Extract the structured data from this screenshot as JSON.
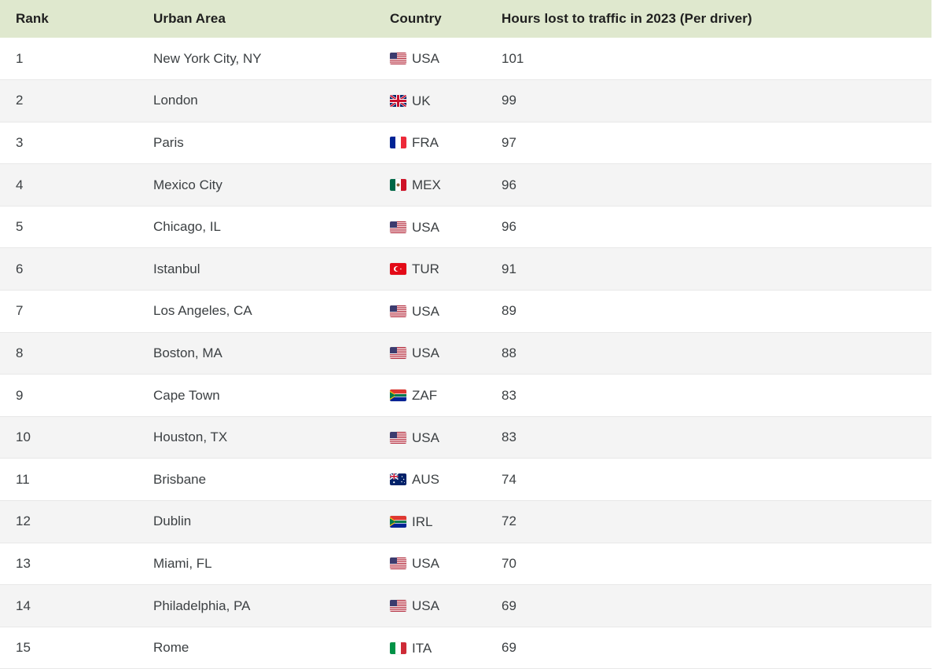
{
  "table": {
    "name": "traffic-congestion-ranking",
    "columns": [
      {
        "key": "rank",
        "label": "Rank"
      },
      {
        "key": "area",
        "label": "Urban Area"
      },
      {
        "key": "country",
        "label": "Country"
      },
      {
        "key": "hours",
        "label": "Hours lost to traffic in 2023 (Per driver)"
      }
    ],
    "colors": {
      "header_background": "#dfe8ce",
      "header_text": "#1f1f1f",
      "row_odd_background": "#ffffff",
      "row_even_background": "#f4f4f4",
      "row_border": "#e8e8e8",
      "body_text": "#3c4043"
    },
    "rows": [
      {
        "rank": "1",
        "area": "New York City, NY",
        "country": "USA",
        "flag": "flag-usa",
        "hours": "101"
      },
      {
        "rank": "2",
        "area": "London",
        "country": "UK",
        "flag": "flag-uk",
        "hours": "99"
      },
      {
        "rank": "3",
        "area": "Paris",
        "country": "FRA",
        "flag": "flag-france",
        "hours": "97"
      },
      {
        "rank": "4",
        "area": "Mexico City",
        "country": "MEX",
        "flag": "flag-mexico",
        "hours": "96"
      },
      {
        "rank": "5",
        "area": "Chicago, IL",
        "country": "USA",
        "flag": "flag-usa",
        "hours": "96"
      },
      {
        "rank": "6",
        "area": "Istanbul",
        "country": "TUR",
        "flag": "flag-turkey",
        "hours": "91"
      },
      {
        "rank": "7",
        "area": "Los Angeles, CA",
        "country": "USA",
        "flag": "flag-usa",
        "hours": "89"
      },
      {
        "rank": "8",
        "area": "Boston, MA",
        "country": "USA",
        "flag": "flag-usa",
        "hours": "88"
      },
      {
        "rank": "9",
        "area": "Cape Town",
        "country": "ZAF",
        "flag": "flag-south-africa",
        "hours": "83"
      },
      {
        "rank": "10",
        "area": "Houston, TX",
        "country": "USA",
        "flag": "flag-usa",
        "hours": "83"
      },
      {
        "rank": "11",
        "area": "Brisbane",
        "country": "AUS",
        "flag": "flag-australia",
        "hours": "74"
      },
      {
        "rank": "12",
        "area": "Dublin",
        "country": "IRL",
        "flag": "flag-south-africa",
        "hours": "72"
      },
      {
        "rank": "13",
        "area": "Miami, FL",
        "country": "USA",
        "flag": "flag-usa",
        "hours": "70"
      },
      {
        "rank": "14",
        "area": "Philadelphia, PA",
        "country": "USA",
        "flag": "flag-usa",
        "hours": "69"
      },
      {
        "rank": "15",
        "area": "Rome",
        "country": "ITA",
        "flag": "flag-italy",
        "hours": "69"
      }
    ]
  }
}
